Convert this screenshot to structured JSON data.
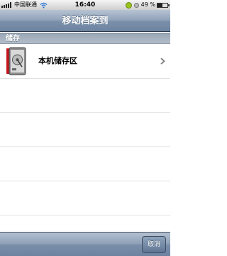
{
  "status_bar": {
    "carrier": "中国联通",
    "time": "16:40",
    "battery_text": "49 %",
    "battery_level": 0.49,
    "icons": [
      "signal-icon",
      "wifi-icon",
      "sync-icon",
      "lock-rotation-icon",
      "battery-icon"
    ]
  },
  "nav": {
    "title": "移动档案到"
  },
  "section": {
    "header": "储存"
  },
  "list": {
    "items": [
      {
        "label": "本机储存区",
        "icon": "local-storage-icon"
      }
    ]
  },
  "toolbar": {
    "cancel_label": "取消"
  },
  "colors": {
    "nav_bar": "#8ea1b8",
    "section_header": "#a7b3c1",
    "toolbar": "#7f93ad",
    "cancel_button": "#6f86a4"
  }
}
